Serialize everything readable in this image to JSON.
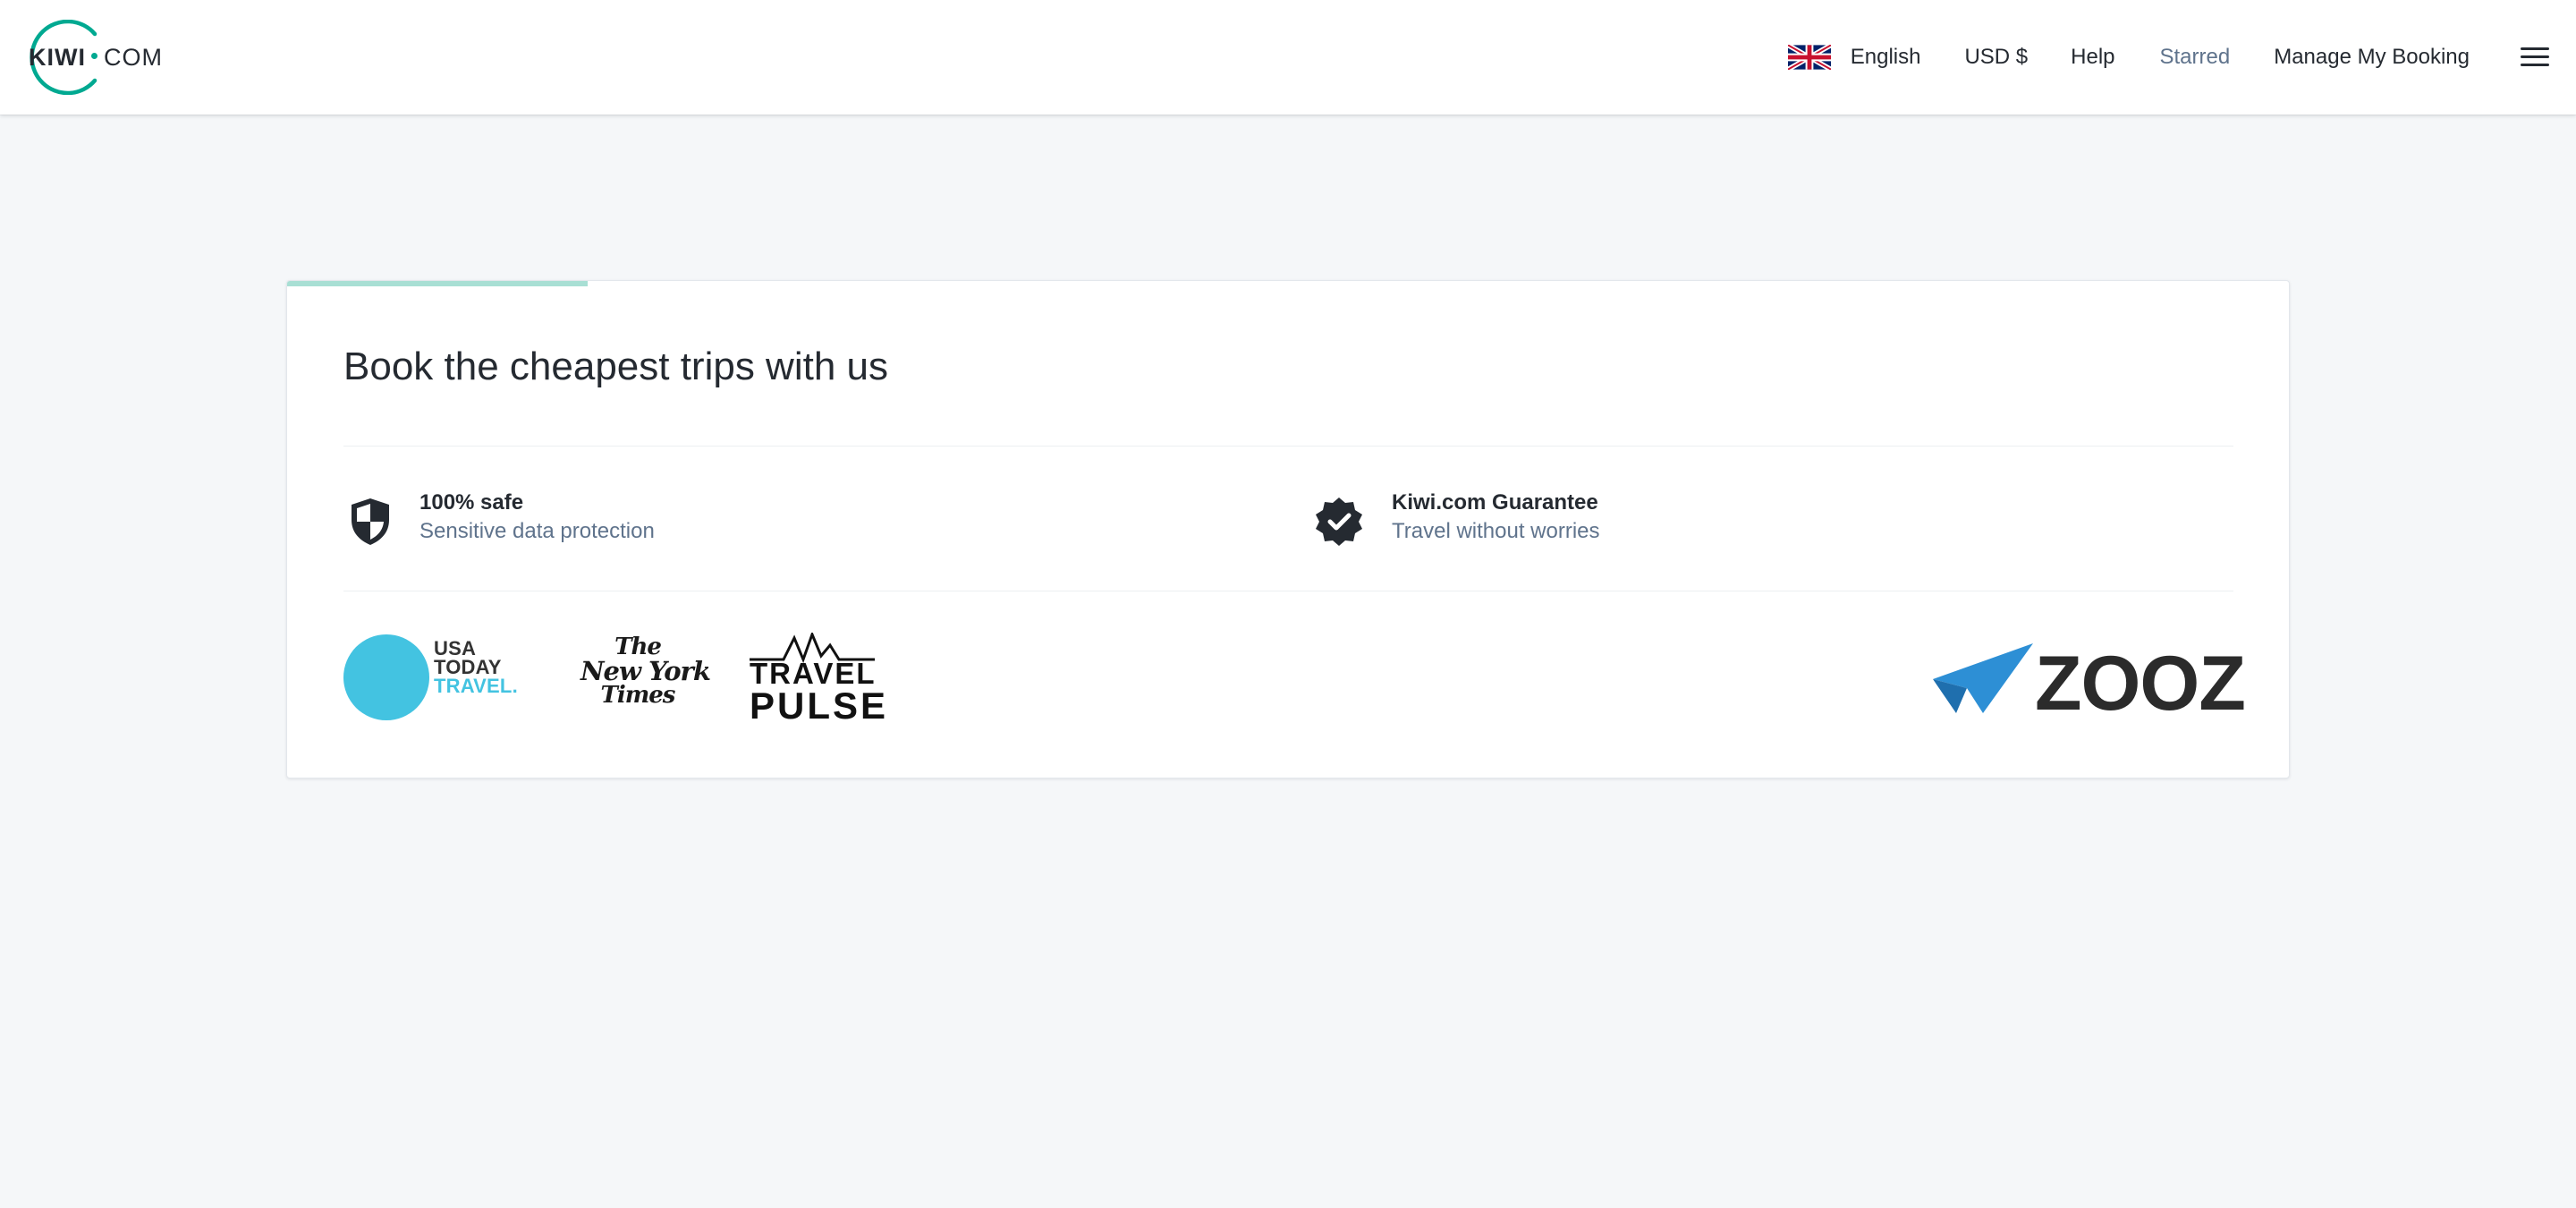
{
  "header": {
    "logo": {
      "brand": "KIWI",
      "suffix": "COM"
    },
    "nav": {
      "language": "English",
      "currency": "USD $",
      "help": "Help",
      "starred": "Starred",
      "manage_booking": "Manage My Booking"
    },
    "icons": {
      "flag": "uk-flag-icon",
      "menu": "hamburger-menu-icon"
    }
  },
  "card": {
    "progress_fraction": 0.15,
    "title": "Book the cheapest trips with us",
    "features": [
      {
        "icon": "shield-icon",
        "title": "100% safe",
        "subtitle": "Sensitive data protection"
      },
      {
        "icon": "verified-badge-icon",
        "title": "Kiwi.com Guarantee",
        "subtitle": "Travel without worries"
      }
    ],
    "press_logos": {
      "usa_today": {
        "line1": "USA",
        "line2": "TODAY",
        "line3": "TRAVEL."
      },
      "nyt": {
        "line1": "The",
        "line2": "New York",
        "line3": "Times"
      },
      "travel_pulse": {
        "line1": "TRAVEL",
        "line2": "PULSE"
      },
      "zooz": {
        "text": "ZOOZ"
      }
    }
  },
  "colors": {
    "brand_teal": "#00a991",
    "progress": "#a8dfd4",
    "text_primary": "#252a31",
    "text_secondary": "#5f738c",
    "page_background": "#f5f7f9",
    "usa_today_blue": "#43c3e1",
    "zooz_blue": "#2d8fd5"
  }
}
